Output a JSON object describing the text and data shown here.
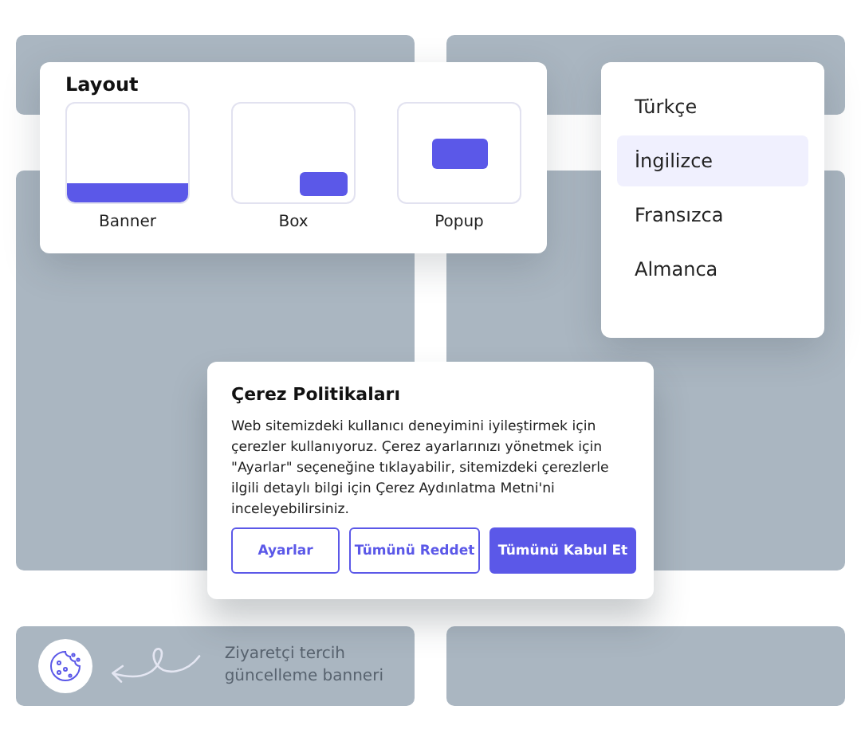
{
  "layout_panel": {
    "title": "Layout",
    "options": [
      {
        "kind": "banner",
        "label": "Banner",
        "selected": false
      },
      {
        "kind": "box",
        "label": "Box",
        "selected": false
      },
      {
        "kind": "popup",
        "label": "Popup",
        "selected": false
      }
    ]
  },
  "language_menu": {
    "items": [
      {
        "label": "Türkçe",
        "selected": false
      },
      {
        "label": "İngilizce",
        "selected": true
      },
      {
        "label": "Fransızca",
        "selected": false
      },
      {
        "label": "Almanca",
        "selected": false
      }
    ]
  },
  "cookie_dialog": {
    "title": "Çerez Politikaları",
    "body": "Web sitemizdeki kullanıcı deneyimini iyileştirmek için çerezler kullanıyoruz. Çerez ayarlarınızı yönetmek için \"Ayarlar\" seçeneğine tıklayabilir, sitemizdeki çerezlerle ilgili detaylı bilgi için Çerez Aydınlatma Metni'ni inceleyebilirsiniz.",
    "buttons": [
      {
        "kind": "outline",
        "label": "Ayarlar"
      },
      {
        "kind": "outline",
        "label": "Tümünü Reddet"
      },
      {
        "kind": "primary",
        "label": "Tümünü Kabul Et"
      }
    ]
  },
  "preference_banner": {
    "caption": "Ziyaretçi tercih güncelleme banneri"
  }
}
